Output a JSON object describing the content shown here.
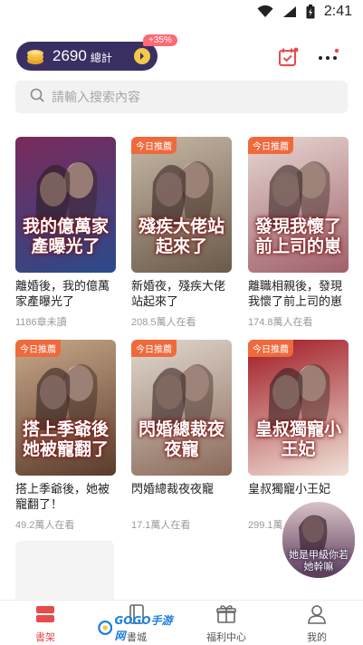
{
  "status_bar": {
    "time": "2:41",
    "icons": [
      "wifi-icon",
      "signal-icon",
      "battery-icon"
    ]
  },
  "header": {
    "points": "2690",
    "points_suffix": "總計",
    "badge": "+35%"
  },
  "search": {
    "placeholder": "請輸入搜索內容"
  },
  "books": [
    {
      "cover_tag": "",
      "cover_title": "我的億萬家產曝光了",
      "title": "離婚後，我的億萬家產曝光了",
      "meta": "1186章未讀",
      "colors": [
        "#7a2a5a",
        "#2a4a8a"
      ]
    },
    {
      "cover_tag": "今日推薦",
      "cover_title": "殘疾大佬站起來了",
      "title": "新婚夜，殘疾大佬站起來了",
      "meta": "208.5萬人在看",
      "colors": [
        "#c7b7a5",
        "#6a5a4a"
      ]
    },
    {
      "cover_tag": "今日推薦",
      "cover_title": "發現我懷了前上司的崽",
      "title": "離職相親後，發現我懷了前上司的崽",
      "meta": "174.8萬人在看",
      "colors": [
        "#e6d7d1",
        "#a0606a"
      ]
    },
    {
      "cover_tag": "今日推薦",
      "cover_title": "搭上季爺後她被寵翻了",
      "title": "搭上季爺後，她被寵翻了！",
      "meta": "49.2萬人在看",
      "colors": [
        "#c9a98a",
        "#5a3a2a"
      ]
    },
    {
      "cover_tag": "今日推薦",
      "cover_title": "閃婚總裁夜夜寵",
      "title": "閃婚總裁夜夜寵",
      "meta": "17.1萬人在看",
      "colors": [
        "#e2d8cf",
        "#8a6a5a"
      ]
    },
    {
      "cover_tag": "今日推薦",
      "cover_title": "皇叔獨寵小王妃",
      "title": "皇叔獨寵小王妃",
      "meta": "299.1萬人在看",
      "colors": [
        "#a01822",
        "#f0e2d8"
      ]
    }
  ],
  "float_promo": {
    "text": "她是甲級你若她幹嘛"
  },
  "bottom_nav": [
    {
      "label": "書架",
      "icon": "bookshelf-icon",
      "active": true
    },
    {
      "label": "書城",
      "icon": "bookstore-icon",
      "active": false
    },
    {
      "label": "福利中心",
      "icon": "gift-icon",
      "active": false
    },
    {
      "label": "我的",
      "icon": "profile-icon",
      "active": false
    }
  ],
  "watermark": {
    "text": "GOGO手游网"
  },
  "colors": {
    "accent": "#e84b4b",
    "pill_bg": "#3a2f63",
    "tag": "#ee6a3d"
  }
}
